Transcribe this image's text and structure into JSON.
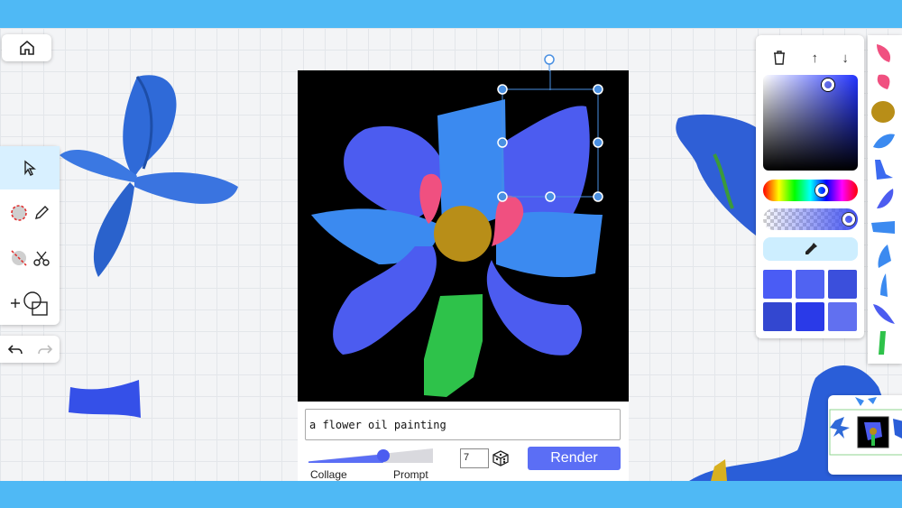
{
  "prompt": {
    "value": "a flower oil painting",
    "placeholder": ""
  },
  "slider": {
    "left_label": "Collage",
    "right_label": "Prompt",
    "value": 0.6
  },
  "seed": {
    "value": "7"
  },
  "render": {
    "label": "Render"
  },
  "toolbar": {
    "icons": [
      "home-icon",
      "pointer-icon",
      "lasso-icon",
      "pencil-icon",
      "erase-lasso-icon",
      "scissors-icon",
      "add-shape-icon",
      "undo-icon",
      "redo-icon"
    ]
  },
  "colors": {
    "accent": "#5b6ef5",
    "picker_base": "#2233ff",
    "swatches": [
      "#4a5cf5",
      "#5063f2",
      "#3b4fdc",
      "#3347d0",
      "#2a3ae8",
      "#6170f0"
    ]
  },
  "color_panel": {
    "icons": [
      "trash-icon",
      "arrow-up-icon",
      "arrow-down-icon",
      "eyedropper-icon"
    ],
    "up_glyph": "↑",
    "down_glyph": "↓"
  }
}
